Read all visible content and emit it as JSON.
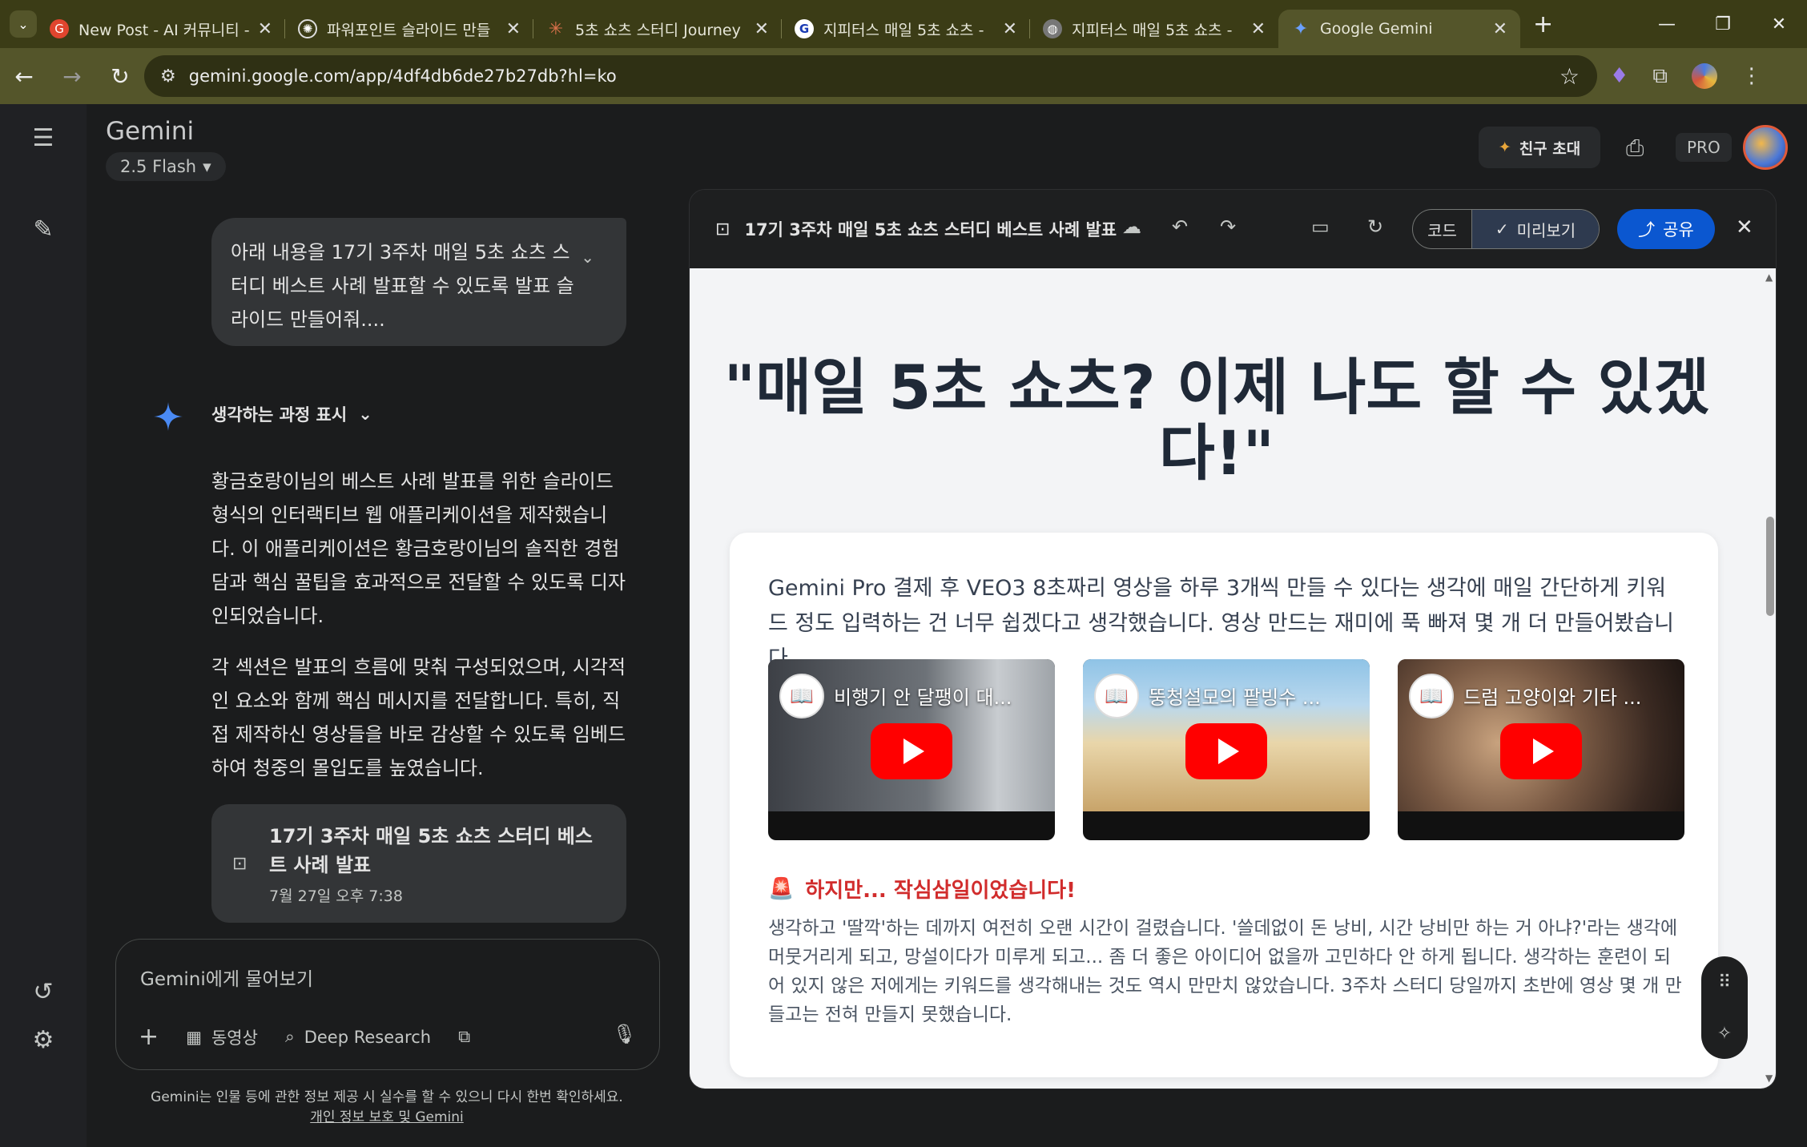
{
  "browser": {
    "tabs": [
      {
        "title": "New Post - AI 커뮤니티 -",
        "icon": "gemini-community-icon",
        "color": "#e0452e"
      },
      {
        "title": "파워포인트 슬라이드 만들",
        "icon": "openai-icon",
        "color": "#555555"
      },
      {
        "title": "5초 쇼츠 스터디 Journey",
        "icon": "claude-icon",
        "color": "#d9704a"
      },
      {
        "title": "지피터스 매일 5초 쇼츠 -",
        "icon": "gpters-icon",
        "color": "#ffffff"
      },
      {
        "title": "지피터스 매일 5초 쇼츠 -",
        "icon": "globe-icon",
        "color": "#888888"
      },
      {
        "title": "Google Gemini",
        "icon": "gemini-icon",
        "color": "#4a7be0"
      }
    ],
    "url": "gemini.google.com/app/4df4db6de27b27db?hl=ko"
  },
  "app": {
    "brand": "Gemini",
    "model": "2.5 Flash",
    "invite_label": "친구 초대",
    "pro_label": "PRO"
  },
  "chat": {
    "user_message": "아래 내용을 17기 3주차 매일 5초 쇼츠 스터디 베스트 사례 발표할 수 있도록 발표 슬라이드 만들어줘....",
    "thinking_label": "생각하는 과정 표시",
    "response_p1": "황금호랑이님의 베스트 사례 발표를 위한 슬라이드 형식의 인터랙티브 웹 애플리케이션을 제작했습니다. 이 애플리케이션은 황금호랑이님의 솔직한 경험담과 핵심 꿀팁을 효과적으로 전달할 수 있도록 디자인되었습니다.",
    "response_p2": "각 섹션은 발표의 흐름에 맞춰 구성되었으며, 시각적인 요소와 함께 핵심 메시지를 전달합니다. 특히, 직접 제작하신 영상들을 바로 감상할 수 있도록 임베드하여 청중의 몰입도를 높였습니다.",
    "artifact_title": "17기 3주차 매일 5초 쇼츠 스터디 베스트 사례 발표",
    "artifact_date": "7월 27일 오후 7:38"
  },
  "input": {
    "placeholder": "Gemini에게 물어보기",
    "tool_video": "동영상",
    "tool_research": "Deep Research"
  },
  "footer": {
    "disclaimer": "Gemini는 인물 등에 관한 정보 제공 시 실수를 할 수 있으니 다시 한번 확인하세요.",
    "privacy_link": "개인 정보 보호 및 Gemini"
  },
  "canvas": {
    "title": "17기 3주차 매일 5초 쇼츠 스터디 베스트 사례 발표",
    "code_label": "코드",
    "preview_label": "미리보기",
    "share_label": "공유"
  },
  "preview": {
    "headline": "\"매일 5초 쇼츠? 이제 나도 할 수 있겠다!\"",
    "intro": "Gemini Pro 결제 후 VEO3 8초짜리 영상을 하루 3개씩 만들 수 있다는 생각에 매일 간단하게 키워드 정도 입력하는 건 너무 쉽겠다고 생각했습니다. 영상 만드는 재미에 푹 빠져 몇 개 더 만들어봤습니다.",
    "videos": [
      {
        "title": "비행기 안 달팽이 대...",
        "bg": "#5a5f66"
      },
      {
        "title": "뚱청설모의 팥빙수 ...",
        "bg": "#c9b48a"
      },
      {
        "title": "드럼 고양이와 기타 ...",
        "bg": "#6b4a3a"
      }
    ],
    "warning_title": "하지만... 작심삼일이었습니다!",
    "warning_body": "생각하고 '딸깍'하는 데까지 여전히 오랜 시간이 걸렸습니다. '쓸데없이 돈 낭비, 시간 낭비만 하는 거 아냐?'라는 생각에 머뭇거리게 되고, 망설이다가 미루게 되고... 좀 더 좋은 아이디어 없을까 고민하다 안 하게 됩니다. 생각하는 훈련이 되어 있지 않은 저에게는 키워드를 생각해내는 것도 역시 만만치 않았습니다. 3주차 스터디 당일까지 초반에 영상 몇 개 만들고는 전혀 만들지 못했습니다."
  }
}
